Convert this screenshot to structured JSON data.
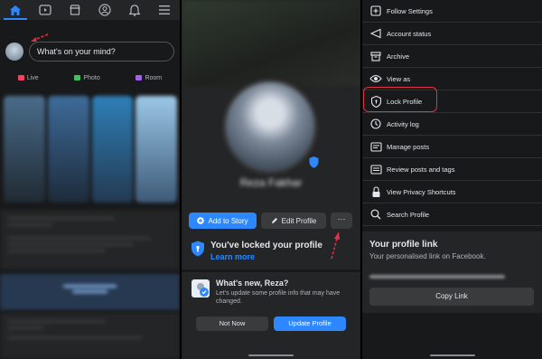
{
  "panel1": {
    "composer_placeholder": "What's on your mind?",
    "actions": [
      {
        "label": "Live",
        "color": "#f3425f"
      },
      {
        "label": "Photo",
        "color": "#45bd62"
      },
      {
        "label": "Room",
        "color": "#a261e8"
      }
    ],
    "nav_icons": [
      "home-icon",
      "video-icon",
      "marketplace-icon",
      "profile-icon",
      "bell-icon",
      "menu-icon"
    ]
  },
  "panel2": {
    "profile_name": "Reza Fakhar",
    "add_to_story_label": "Add to Story",
    "edit_profile_label": "Edit Profile",
    "more_label": "···",
    "locked_title": "You've locked your profile",
    "learn_more_label": "Learn more",
    "whats_new_title": "What's new, Reza?",
    "whats_new_text": "Let's update some profile info that may have changed.",
    "not_now_label": "Not Now",
    "update_profile_label": "Update Profile"
  },
  "panel3": {
    "menu": [
      {
        "label": "Follow Settings",
        "icon": "follow-settings-icon"
      },
      {
        "label": "Account status",
        "icon": "account-status-icon"
      },
      {
        "label": "Archive",
        "icon": "archive-icon"
      },
      {
        "label": "View as",
        "icon": "eye-icon"
      },
      {
        "label": "Lock Profile",
        "icon": "shield-icon"
      },
      {
        "label": "Activity log",
        "icon": "activity-log-icon"
      },
      {
        "label": "Manage posts",
        "icon": "manage-posts-icon"
      },
      {
        "label": "Review posts and tags",
        "icon": "review-icon"
      },
      {
        "label": "View Privacy Shortcuts",
        "icon": "lock-icon"
      },
      {
        "label": "Search Profile",
        "icon": "search-icon"
      }
    ],
    "profile_link_title": "Your profile link",
    "profile_link_sub": "Your personalised link on Facebook.",
    "copy_link_label": "Copy Link"
  },
  "colors": {
    "accent": "#2d88ff",
    "highlight": "#e0324b",
    "background": "#18191a",
    "surface": "#242526"
  }
}
